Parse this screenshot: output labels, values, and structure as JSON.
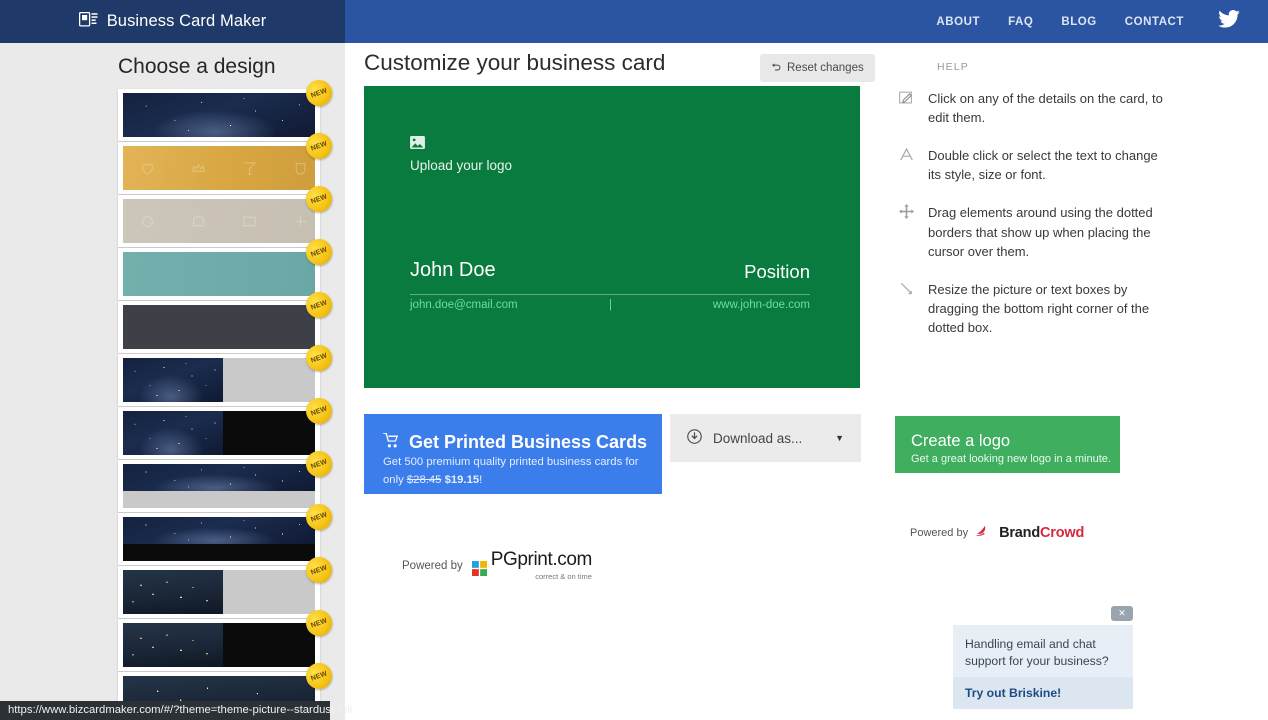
{
  "header": {
    "brand": "Business Card Maker",
    "logo_icon": "business-card-icon",
    "nav": [
      {
        "label": "ABOUT"
      },
      {
        "label": "FAQ"
      },
      {
        "label": "BLOG"
      },
      {
        "label": "CONTACT"
      }
    ],
    "social_icon": "twitter-icon",
    "colors": {
      "left_block": "#1f3a68",
      "bar": "#2b55a3"
    }
  },
  "sidebar": {
    "title": "Choose a design",
    "badge_label": "NEW",
    "thumbnails": [
      {
        "name": "stardust-full",
        "style": "stars",
        "new": true
      },
      {
        "name": "gold-icons",
        "style": "gold",
        "new": true
      },
      {
        "name": "sand-icons",
        "style": "sand",
        "new": true
      },
      {
        "name": "teal-plain",
        "style": "teal",
        "new": true
      },
      {
        "name": "charcoal-plain",
        "style": "dark",
        "new": true
      },
      {
        "name": "stardust-grey-split",
        "style": "stars-grey",
        "new": true
      },
      {
        "name": "stardust-black-split",
        "style": "stars-black",
        "new": true
      },
      {
        "name": "stardust-grey-band",
        "style": "stars-grey-band",
        "new": true
      },
      {
        "name": "stardust-black-band",
        "style": "stars-black-band",
        "new": true
      },
      {
        "name": "city-grey-split",
        "style": "city-grey",
        "new": true
      },
      {
        "name": "city-black-split",
        "style": "city-black",
        "new": true
      },
      {
        "name": "city-partial",
        "style": "city",
        "new": true
      }
    ]
  },
  "main": {
    "page_title": "Customize your business card",
    "reset_label": "Reset changes",
    "reset_icon": "undo-icon"
  },
  "card": {
    "background": "#0a7b3e",
    "logo_icon": "image-placeholder-icon",
    "logo_label": "Upload your logo",
    "name": "John Doe",
    "position": "Position",
    "email": "john.doe@cmail.com",
    "separator": "|",
    "website": "www.john-doe.com",
    "link_color": "#6fdd9c"
  },
  "actions": {
    "print": {
      "icon": "cart-icon",
      "title": "Get Printed Business Cards",
      "sub_prefix": "Get 500 premium quality printed business cards for only ",
      "old_price": "$28.45",
      "new_price": "$19.15",
      "sub_suffix": "!",
      "color": "#3b7dea"
    },
    "download": {
      "icon": "download-icon",
      "label": "Download as...",
      "caret": "▼"
    },
    "pgprint": {
      "powered_label": "Powered by",
      "name": "PGprint.com",
      "tagline": "correct & on time"
    },
    "create_logo": {
      "title": "Create a logo",
      "sub": "Get a great looking new logo in a minute.",
      "color": "#3fae5f"
    },
    "brandcrowd": {
      "powered_label": "Powered by",
      "name_part1": "Brand",
      "name_part2": "Crowd",
      "accent": "#d6293e"
    }
  },
  "help": {
    "title": "HELP",
    "items": [
      {
        "icon": "edit-pencil-icon",
        "text": "Click on any of the details on the card, to edit them."
      },
      {
        "icon": "text-style-icon",
        "text": "Double click or select the text to change its style, size or font."
      },
      {
        "icon": "move-arrows-icon",
        "text": "Drag elements around using the dotted borders that show up when placing the cursor over them."
      },
      {
        "icon": "resize-handle-icon",
        "text": "Resize the picture or text boxes by dragging the bottom right corner of the dotted box."
      }
    ]
  },
  "chat_popup": {
    "close_label": "✕",
    "message": "Handling email and chat support for your business?",
    "cta": "Try out Briskine!"
  },
  "status_bar": {
    "url": "https://www.bizcardmaker.com/#/?theme=theme-picture--stardust-full"
  }
}
